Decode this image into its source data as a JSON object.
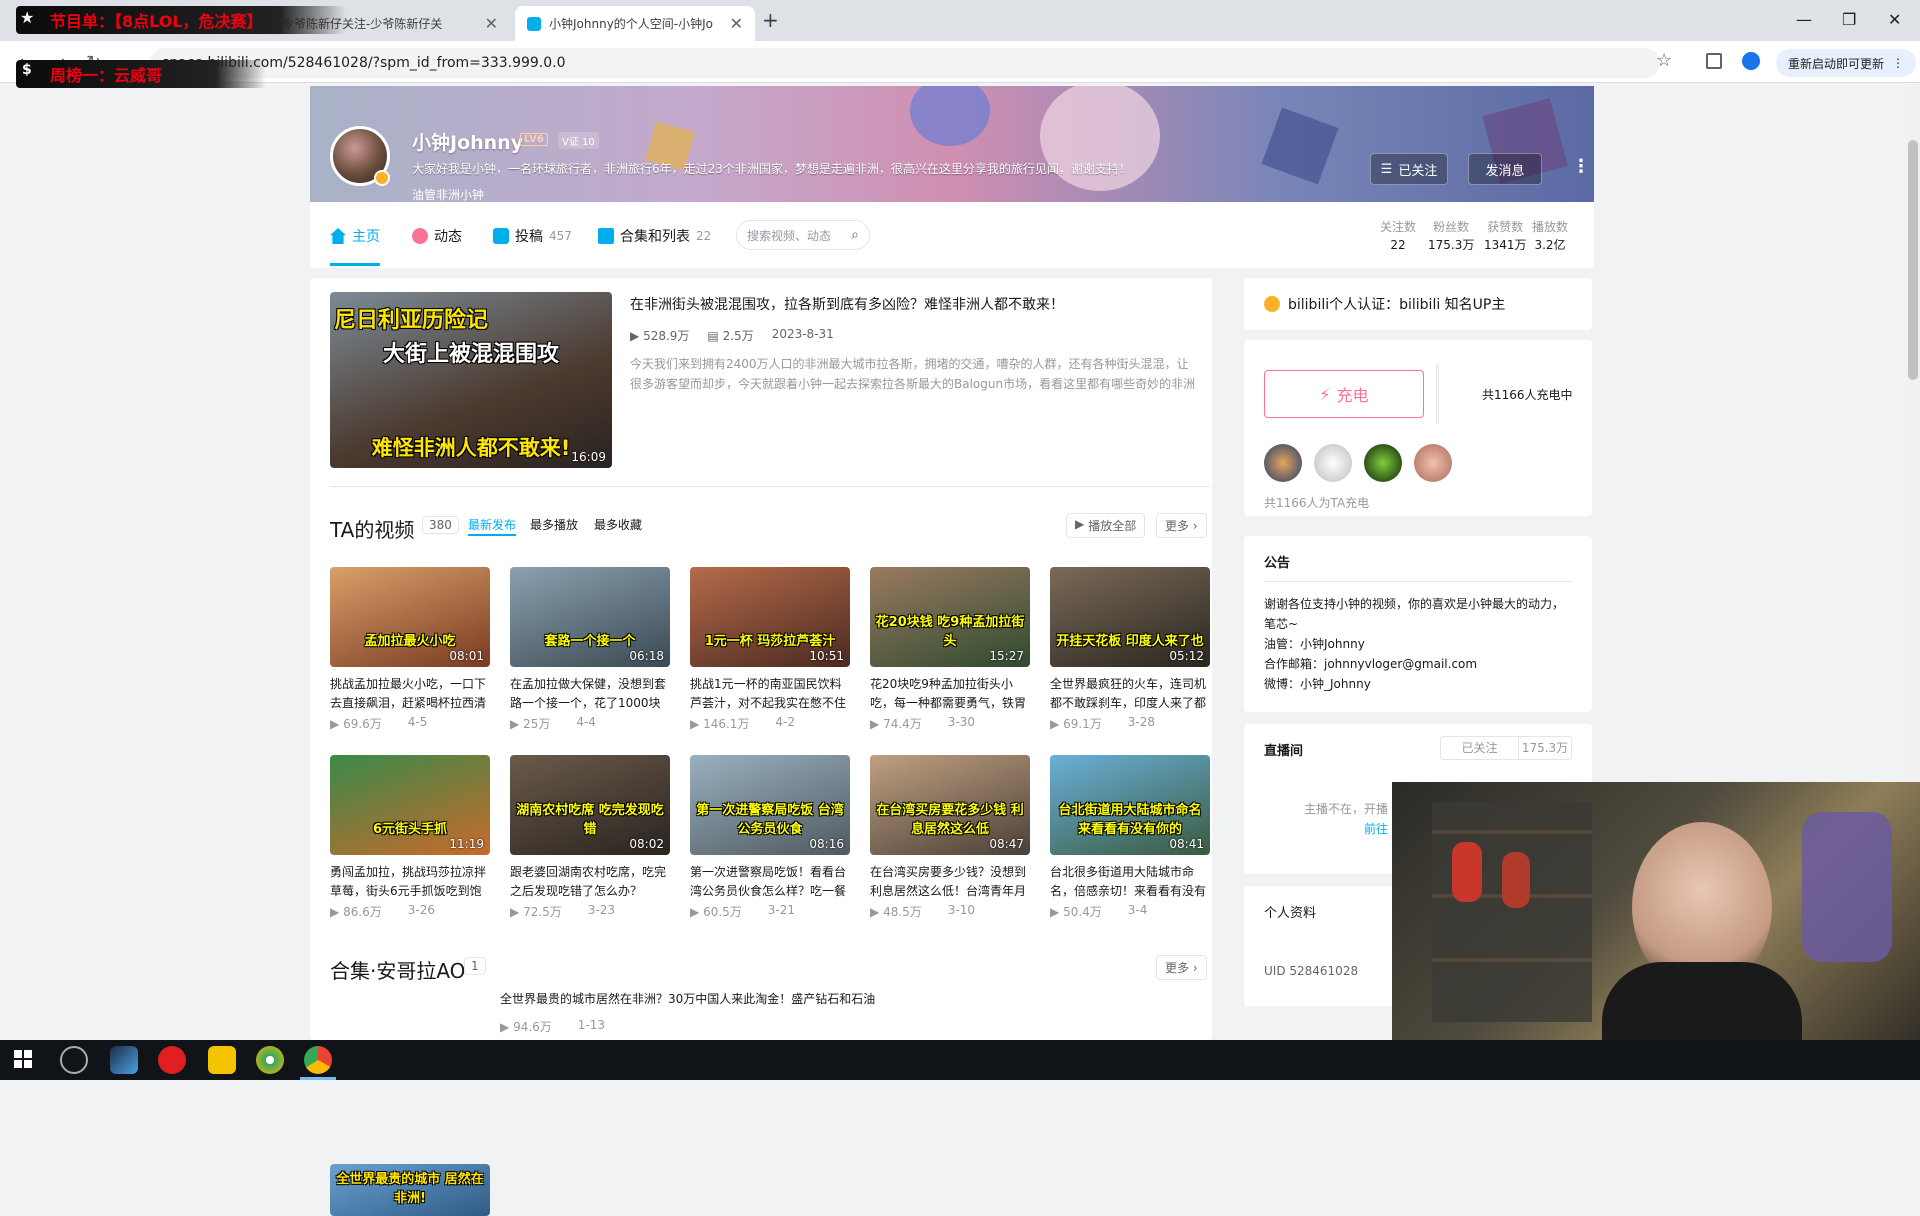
{
  "overlay": {
    "line1": "节目单：【8点LOL，危决赛】",
    "line2": "周榜一：云威哥"
  },
  "browser": {
    "tabs": [
      {
        "title": "令爷陈新仔关注-少爷陈新仔关"
      },
      {
        "title": "小钟Johnny的个人空间-小钟Jo"
      }
    ],
    "url": "space.bilibili.com/528461028/?spm_id_from=333.999.0.0",
    "restart_label": "重新启动即可更新"
  },
  "profile": {
    "name": "小钟Johnny",
    "level": "LV6",
    "vip": "V证 10",
    "sign": "大家好我是小钟，一名环球旅行者，非洲旅行6年，走过23个非洲国家，梦想是走遍非洲，很高兴在这里分享我的旅行见闻，谢谢支持！",
    "sub": "油管非洲小钟",
    "follow_label": "已关注",
    "message_label": "发消息"
  },
  "nav": {
    "items": [
      {
        "label": "主页",
        "count": ""
      },
      {
        "label": "动态",
        "count": ""
      },
      {
        "label": "投稿",
        "count": "457"
      },
      {
        "label": "合集和列表",
        "count": "22"
      }
    ],
    "search_placeholder": "搜索视频、动态",
    "stats": [
      {
        "k": "关注数",
        "v": "22"
      },
      {
        "k": "粉丝数",
        "v": "175.3万"
      },
      {
        "k": "获赞数",
        "v": "1341万"
      },
      {
        "k": "播放数",
        "v": "3.2亿"
      }
    ]
  },
  "featured": {
    "thumb_top": "尼日利亚历险记",
    "thumb_mid": "大街上被混混围攻",
    "thumb_bot": "难怪非洲人都不敢来!",
    "duration": "16:09",
    "title": "在非洲街头被混混围攻，拉各斯到底有多凶险？难怪非洲人都不敢来！",
    "views": "528.9万",
    "comments": "2.5万",
    "date": "2023-8-31",
    "desc": "今天我们来到拥有2400万人口的非洲最大城市拉各斯，拥堵的交通，嘈杂的人群，还有各种街头混混，让很多游客望而却步，今天就跟着小钟一起去探索拉各斯最大的Balogun市场，看看这里都有哪些奇妙的非洲小"
  },
  "videos_section": {
    "title": "TA的视频",
    "count": "380",
    "sorts": [
      "最新发布",
      "最多播放",
      "最多收藏"
    ],
    "play_all": "播放全部",
    "more": "更多"
  },
  "videos": [
    {
      "cap": "孟加拉最火小吃",
      "duration": "08:01",
      "title": "挑战孟加拉最火小吃，一口下去直接飙泪，赶紧喝杯拉西清",
      "views": "69.6万",
      "date": "4-5"
    },
    {
      "cap": "套路一个接一个",
      "duration": "06:18",
      "title": "在孟加拉做大保健，没想到套路一个接一个，花了1000块",
      "views": "25万",
      "date": "4-4"
    },
    {
      "cap": "1元一杯 玛莎拉芦荟汁",
      "duration": "10:51",
      "title": "挑战1元一杯的南亚国民饮料芦荟汁，对不起我实在憋不住",
      "views": "146.1万",
      "date": "4-2"
    },
    {
      "cap": "花20块钱 吃9种孟加拉街头",
      "duration": "15:27",
      "title": "花20块吃9种孟加拉街头小吃，每一种都需要勇气，铁胃",
      "views": "74.4万",
      "date": "3-30"
    },
    {
      "cap": "开挂天花板 印度人来了也",
      "duration": "05:12",
      "title": "全世界最疯狂的火车，连司机都不敢踩刹车，印度人来了都",
      "views": "69.1万",
      "date": "3-28"
    },
    {
      "cap": "6元街头手抓",
      "duration": "11:19",
      "title": "勇闯孟加拉，挑战玛莎拉凉拌草莓，街头6元手抓饭吃到饱",
      "views": "86.6万",
      "date": "3-26"
    },
    {
      "cap": "湖南农村吃席 吃完发现吃错",
      "duration": "08:02",
      "title": "跟老婆回湖南农村吃席，吃完之后发现吃错了怎么办？",
      "views": "72.5万",
      "date": "3-23"
    },
    {
      "cap": "第一次进警察局吃饭 台湾公务员伙食",
      "duration": "08:16",
      "title": "第一次进警察局吃饭！看看台湾公务员伙食怎么样？吃一餐",
      "views": "60.5万",
      "date": "3-21"
    },
    {
      "cap": "在台湾买房要花多少钱 利息居然这么低",
      "duration": "08:47",
      "title": "在台湾买房要多少钱？没想到利息居然这么低！台湾青年月",
      "views": "48.5万",
      "date": "3-10"
    },
    {
      "cap": "台北街道用大陆城市命名 来看看有没有你的",
      "duration": "08:41",
      "title": "台北很多街道用大陆城市命名，倍感亲切！来看看有没有",
      "views": "50.4万",
      "date": "3-4"
    }
  ],
  "collection": {
    "title": "合集·安哥拉AO",
    "count": "1",
    "more": "更多",
    "thumb_cap": "全世界最贵的城市 居然在非洲!",
    "video_title": "全世界最贵的城市居然在非洲？30万中国人来此淘金！盛产钻石和石油",
    "views": "94.6万",
    "date": "1-13"
  },
  "sidebar": {
    "cert": "bilibili个人认证：bilibili 知名UP主",
    "charge_label": "充电",
    "charge_count": "共1166人充电中",
    "charge_people": "共1166人为TA充电",
    "notice_title": "公告",
    "notice_lines": [
      "谢谢各位支持小钟的视频，你的喜欢是小钟最大的动力，笔芯~",
      "油管：小钟Johnny",
      "合作邮箱：johnnyvloger@gmail.com",
      "微博：小钟_Johnny"
    ],
    "live_title": "直播间",
    "live_follow": "已关注",
    "live_fans": "175.3万",
    "live_status": "主播不在，开播",
    "live_goto": "前往",
    "profile_title": "个人资料",
    "uid": "UID  528461028"
  },
  "colors": {
    "brand_blue": "#00aeec",
    "brand_pink": "#fb7299"
  }
}
